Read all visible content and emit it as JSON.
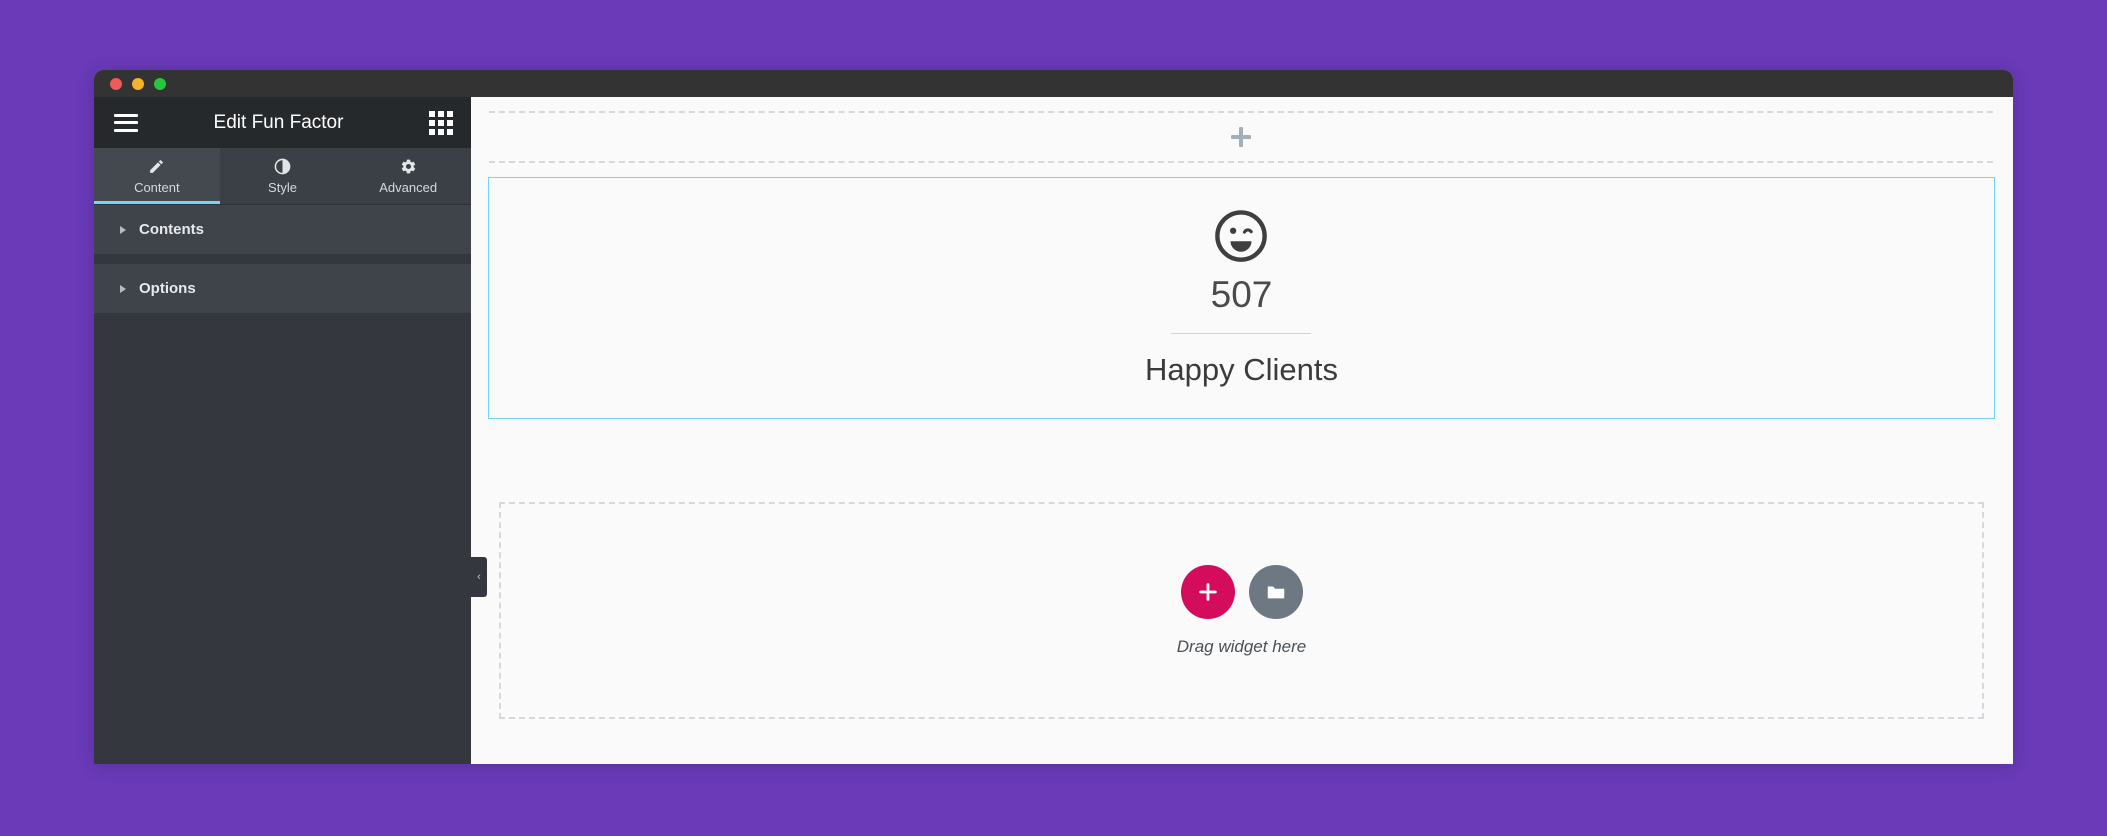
{
  "desktop": {
    "background_color": "#6a3ab9"
  },
  "window": {
    "titlebar": {
      "buttons": [
        {
          "name": "close",
          "color": "#f1595b"
        },
        {
          "name": "minimize",
          "color": "#f5b22c"
        },
        {
          "name": "maximize",
          "color": "#27c63f"
        }
      ]
    }
  },
  "panel": {
    "menu_icon": "hamburger-menu-icon",
    "title": "Edit Fun Factor",
    "apps_icon": "grid-apps-icon",
    "tabs": [
      {
        "label": "Content",
        "icon": "pencil-icon",
        "active": true
      },
      {
        "label": "Style",
        "icon": "contrast-icon",
        "active": false
      },
      {
        "label": "Advanced",
        "icon": "gear-icon",
        "active": false
      }
    ],
    "active_tab_indicator_color": "#71d7f7",
    "sections": [
      {
        "label": "Contents",
        "expanded": false
      },
      {
        "label": "Options",
        "expanded": false
      }
    ],
    "collapse_handle_glyph": "‹"
  },
  "canvas": {
    "add_section": {
      "icon": "plus-icon",
      "label": ""
    },
    "selected_widget": {
      "selection_color": "#71d7f7",
      "icon": "winking-smiley-icon",
      "number": "507",
      "title": "Happy Clients"
    },
    "drop_zone": {
      "add_button_icon": "plus-icon",
      "add_button_color": "#d30c5c",
      "templates_button_icon": "folder-icon",
      "templates_button_color": "#6d7882",
      "label": "Drag widget here"
    }
  }
}
